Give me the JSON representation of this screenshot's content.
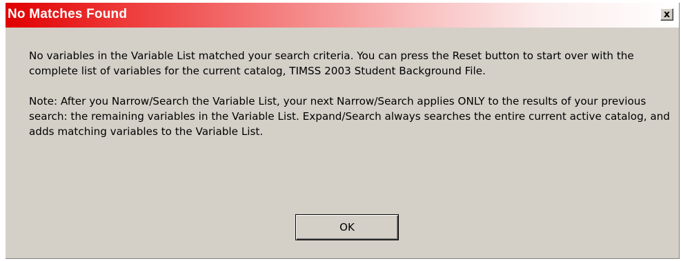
{
  "dialog": {
    "title": "No Matches Found",
    "close_glyph": "x",
    "close_icon": "close-icon",
    "message_1": "No variables in the Variable List matched your search criteria.  You can press the Reset button to start over with the complete list of variables for the current catalog, TIMSS 2003 Student Background File.",
    "message_2": "Note:  After you Narrow/Search the Variable List, your next Narrow/Search applies ONLY to the results of your previous search: the remaining variables in the Variable List.  Expand/Search always searches the entire current active catalog, and adds matching variables to the Variable List.",
    "ok_label": "OK"
  },
  "colors": {
    "titlebar_start": "#e00000",
    "titlebar_end": "#ffffff",
    "dialog_background": "#d4d0c8"
  }
}
